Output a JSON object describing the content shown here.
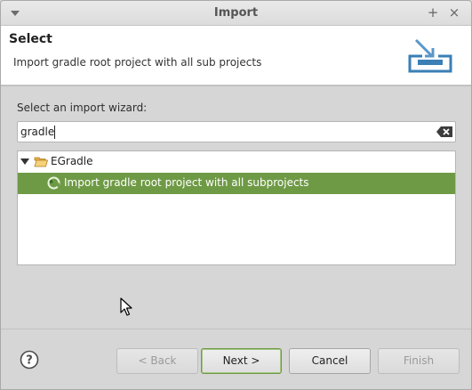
{
  "window": {
    "title": "Import"
  },
  "header": {
    "title": "Select",
    "description": "Import gradle root project with all sub projects",
    "icon": "import-wizard-icon"
  },
  "body": {
    "wizard_label": "Select an import wizard:",
    "search": {
      "value": "gradle",
      "clear_icon": "clear-text-icon"
    },
    "tree": {
      "items": [
        {
          "label": "EGradle",
          "icon": "folder-open-icon",
          "expanded": true
        },
        {
          "label": "Import gradle root project with all subprojects",
          "icon": "gradle-icon",
          "selected": true
        }
      ]
    }
  },
  "footer": {
    "help_icon": "help-icon",
    "buttons": {
      "back": "< Back",
      "next": "Next >",
      "cancel": "Cancel",
      "finish": "Finish"
    }
  },
  "colors": {
    "selection": "#6f9a45",
    "dialog_bg": "#d6d6d6",
    "header_bg": "#ffffff",
    "icon_blue": "#3a7fb5"
  }
}
